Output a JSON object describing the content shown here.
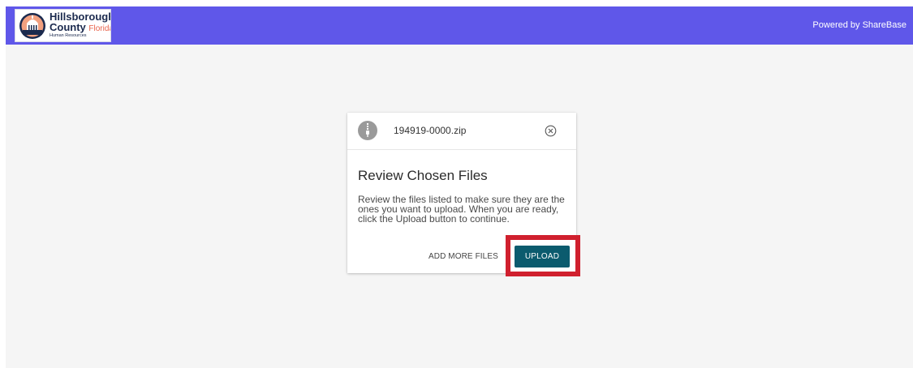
{
  "header": {
    "background_color": "#5f57e9",
    "logo": {
      "line1": "Hillsborough",
      "line2": "County",
      "line2_accent": "Florida",
      "line3": "Human Resources"
    },
    "powered_by": "Powered by ShareBase"
  },
  "dialog": {
    "file": {
      "icon": "zip-file-icon",
      "name": "194919-0000.zip",
      "remove_icon": "close-circle-icon"
    },
    "title": "Review Chosen Files",
    "description": "Review the files listed to make sure they are the ones you want to upload. When you are ready, click the Upload button to continue.",
    "add_more_label": "ADD MORE FILES",
    "upload_label": "UPLOAD",
    "upload_color": "#0b5b6e",
    "highlight_color": "#d0202e"
  }
}
